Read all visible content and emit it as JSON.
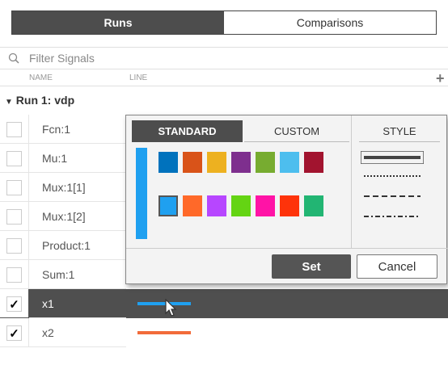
{
  "tabs": {
    "runs": "Runs",
    "comparisons": "Comparisons"
  },
  "filter": {
    "placeholder": "Filter Signals"
  },
  "columns": {
    "name": "NAME",
    "line": "LINE",
    "add": "+"
  },
  "run": {
    "label": "Run 1: vdp"
  },
  "signals": [
    {
      "name": "Fcn:1",
      "checked": false,
      "check_glyph": ""
    },
    {
      "name": "Mu:1",
      "checked": false,
      "check_glyph": ""
    },
    {
      "name": "Mux:1[1]",
      "checked": false,
      "check_glyph": ""
    },
    {
      "name": "Mux:1[2]",
      "checked": false,
      "check_glyph": ""
    },
    {
      "name": "Product:1",
      "checked": false,
      "check_glyph": ""
    },
    {
      "name": "Sum:1",
      "checked": false,
      "check_glyph": ""
    },
    {
      "name": "x1",
      "checked": true,
      "check_glyph": "✓",
      "selected": true,
      "line_color": "#1fa0f0"
    },
    {
      "name": "x2",
      "checked": true,
      "check_glyph": "✓",
      "line_color": "#f26b3a"
    }
  ],
  "popup": {
    "tab_standard": "STANDARD",
    "tab_custom": "CUSTOM",
    "tab_style": "STYLE",
    "preview_color": "#1fa0f0",
    "colors_row1": [
      "#0072bd",
      "#d95319",
      "#edb120",
      "#7e2f8e",
      "#77ac30",
      "#4dbeee",
      "#a2142f"
    ],
    "colors_row2": [
      "#1fa0f0",
      "#ff6929",
      "#b746ff",
      "#64d413",
      "#ff13a6",
      "#fe330a",
      "#22b573"
    ],
    "selected_color": "#1fa0f0",
    "line_styles": [
      "solid",
      "dotted",
      "dashed",
      "dash-dot"
    ],
    "selected_style": "solid",
    "set_label": "Set",
    "cancel_label": "Cancel"
  }
}
